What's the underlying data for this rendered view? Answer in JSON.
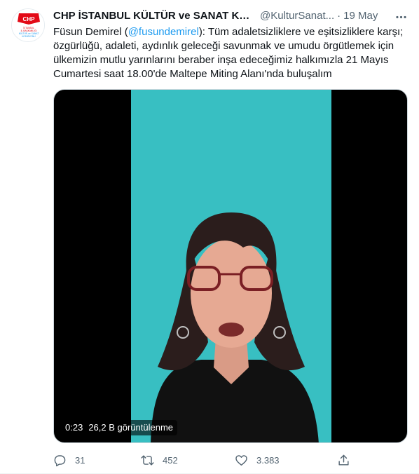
{
  "tweet": {
    "display_name": "CHP İSTANBUL KÜLTÜR ve SANAT KOM...",
    "handle": "@KulturSanat...",
    "separator": "·",
    "date": "19 May",
    "text": {
      "author": "Füsun Demirel (",
      "mention": "@fusundemirel",
      "body": "): Tüm adaletsizliklere ve eşitsizliklere karşı; özgürlüğü, adaleti, aydınlık geleceği savunmak ve umudu örgütlemek için ülkemizin mutlu yarınlarını beraber inşa edeceğimiz halkımızla 21 Mayıs Cumartesi saat 18.00'de Maltepe Miting Alanı'nda buluşalım"
    },
    "avatar": {
      "logo_text": "CHP",
      "org_lines": [
        "İSTANBUL",
        "İL BAŞKANLIĞI",
        "KÜLTÜR ve SANAT",
        "KOMİSYONU"
      ]
    },
    "video": {
      "duration": "0:23",
      "views": "26,2 B görüntülenme",
      "background_color": "#38bfc2"
    },
    "actions": {
      "replies": "31",
      "retweets": "452",
      "likes": "3.383"
    },
    "icons": [
      "more-icon",
      "reply-icon",
      "retweet-icon",
      "like-icon",
      "share-icon"
    ],
    "colors": {
      "accent": "#1d9bf0",
      "secondary_text": "#536471",
      "brand_red": "#e30a17"
    }
  }
}
